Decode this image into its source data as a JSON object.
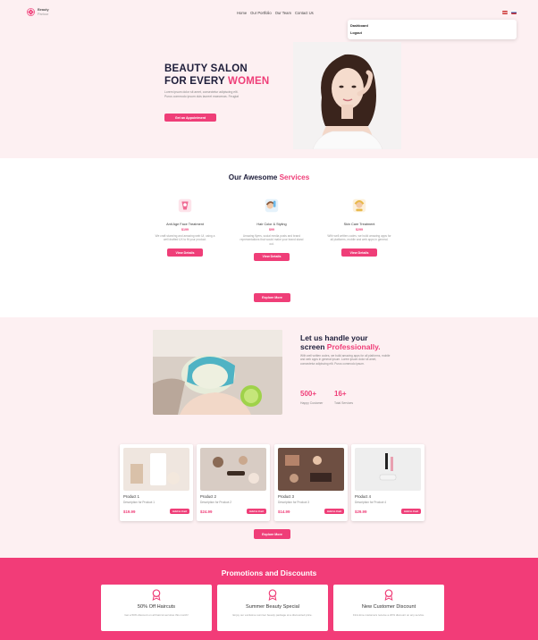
{
  "colors": {
    "accent": "#ef3e78",
    "hero_bg": "#fdf0f2",
    "promo_bg": "#f23c78"
  },
  "header": {
    "logo_line1": "Beauty",
    "logo_line2": "Parlour",
    "nav": [
      "Home",
      "Our Portfolio",
      "Our Team",
      "Contact Us"
    ],
    "dropdown": [
      "Dashboard",
      "Logout"
    ]
  },
  "hero": {
    "title_line1": "BEAUTY SALON",
    "title_line2_prefix": "FOR EVERY ",
    "title_line2_highlight": "WOMEN",
    "text": "Lorem ipsum dolor sit amet, consectetur adipiscing elit. Purus commodo ipsum duis laoreet maecenas. Feugiat",
    "button": "Get an Appointment"
  },
  "services": {
    "title_prefix": "Our Awesome ",
    "title_highlight": "Services",
    "items": [
      {
        "name": "Anti Age Face Treatment",
        "price": "$199",
        "desc": "We craft stunning and amazing web UI, using a well drafted UX to fit your product.",
        "button": "View Details",
        "icon": "face-mask-icon"
      },
      {
        "name": "Hair Color & Styling",
        "price": "$99",
        "desc": "Amazing flyers, social media posts and brand representations that would make your brand stand out.",
        "button": "View Details",
        "icon": "hair-styling-icon"
      },
      {
        "name": "Skin Care Treatment",
        "price": "$299",
        "desc": "With well written codes, we build amazing apps for all platforms, mobile and web apps in general.",
        "button": "View Details",
        "icon": "skin-care-icon"
      }
    ],
    "explore": "Explore More"
  },
  "handle": {
    "title_line1": "Let us handle your",
    "title_line2_prefix": "screen ",
    "title_line2_highlight": "Professionally.",
    "text": "With well written codes, we build amazing apps for all platforms, mobile and web apps in general ipsum. Lorem ipsum dolor sit amet, consectetur adipiscing elit. Purus commodo ipsum.",
    "stats": [
      {
        "value": "500+",
        "label": "Happy Customer"
      },
      {
        "value": "16+",
        "label": "Total Services"
      }
    ]
  },
  "products": {
    "items": [
      {
        "name": "Product 1",
        "desc": "Description for Product 1",
        "price": "$19.99",
        "button": "Add to Cart"
      },
      {
        "name": "Product 2",
        "desc": "Description for Product 2",
        "price": "$24.99",
        "button": "Add to Cart"
      },
      {
        "name": "Product 3",
        "desc": "Description for Product 3",
        "price": "$14.99",
        "button": "Add to Cart"
      },
      {
        "name": "Product 4",
        "desc": "Description for Product 4",
        "price": "$29.99",
        "button": "Add to Cart"
      }
    ],
    "explore": "Explore More"
  },
  "promotions": {
    "title": "Promotions and Discounts",
    "items": [
      {
        "name": "50% Off Haircuts",
        "desc": "Get a 50% discount on all haircut services this month!"
      },
      {
        "name": "Summer Beauty Special",
        "desc": "Enjoy our exclusive summer beauty package at a discounted price."
      },
      {
        "name": "New Customer Discount",
        "desc": "First-time customers receive a 20% discount on any service."
      }
    ]
  }
}
